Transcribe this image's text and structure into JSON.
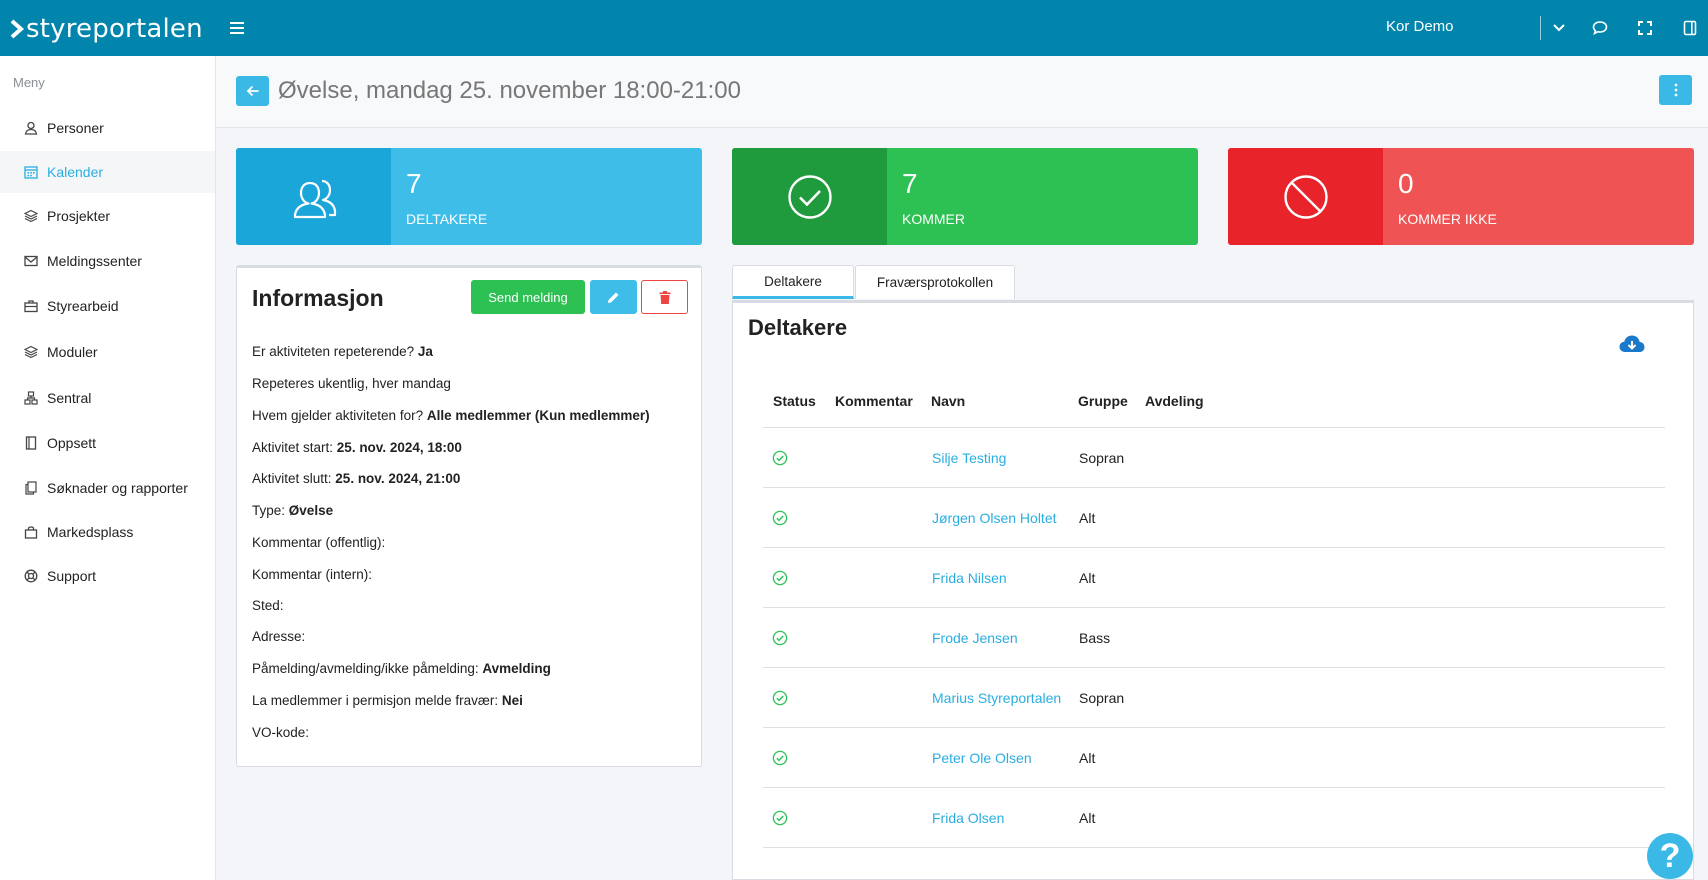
{
  "header": {
    "brand": "styreportalen",
    "org_name": "Kor Demo",
    "icons": [
      "menu-icon",
      "chevron-down-icon",
      "chat-bubble-icon",
      "fullscreen-icon",
      "sidebar-panel-icon"
    ]
  },
  "sidebar": {
    "title": "Meny",
    "items": [
      {
        "label": "Personer",
        "icon": "user-icon"
      },
      {
        "label": "Kalender",
        "icon": "calendar-icon",
        "active": true
      },
      {
        "label": "Prosjekter",
        "icon": "layers-icon"
      },
      {
        "label": "Meldingssenter",
        "icon": "mail-icon"
      },
      {
        "label": "Styrearbeid",
        "icon": "briefcase-icon"
      },
      {
        "label": "Moduler",
        "icon": "layers-icon"
      },
      {
        "label": "Sentral",
        "icon": "sitemap-icon"
      },
      {
        "label": "Oppsett",
        "icon": "book-icon"
      },
      {
        "label": "Søknader og rapporter",
        "icon": "documents-icon"
      },
      {
        "label": "Markedsplass",
        "icon": "shopping-bag-icon"
      },
      {
        "label": "Support",
        "icon": "lifebuoy-icon"
      }
    ]
  },
  "page": {
    "title": "Øvelse, mandag 25. november 18:00-21:00"
  },
  "stats": [
    {
      "value": "7",
      "label": "DELTAKERE",
      "icon": "users-icon",
      "color": "#3dbde8"
    },
    {
      "value": "7",
      "label": "KOMMER",
      "icon": "check-circle-icon",
      "color": "#2cc152"
    },
    {
      "value": "0",
      "label": "KOMMER IKKE",
      "icon": "ban-icon",
      "color": "#ef5353"
    }
  ],
  "info": {
    "title": "Informasjon",
    "send_label": "Send melding",
    "lines": [
      {
        "label": "Er aktiviteten repeterende?",
        "value": "Ja"
      },
      {
        "label": "Repeteres ukentlig, hver mandag",
        "value": ""
      },
      {
        "label": "Hvem gjelder aktiviteten for?",
        "value": "Alle medlemmer (Kun medlemmer)"
      },
      {
        "label": "Aktivitet start:",
        "value": "25. nov. 2024, 18:00"
      },
      {
        "label": "Aktivitet slutt:",
        "value": "25. nov. 2024, 21:00"
      },
      {
        "label": "Type:",
        "value": "Øvelse"
      },
      {
        "label": "Kommentar (offentlig):",
        "value": ""
      },
      {
        "label": "Kommentar (intern):",
        "value": ""
      },
      {
        "label": "Sted:",
        "value": ""
      },
      {
        "label": "Adresse:",
        "value": ""
      },
      {
        "label": "Påmelding/avmelding/ikke påmelding:",
        "value": "Avmelding"
      },
      {
        "label": "La medlemmer i permisjon melde fravær:",
        "value": "Nei"
      },
      {
        "label": "VO-kode:",
        "value": ""
      }
    ]
  },
  "tabs": [
    {
      "label": "Deltakere",
      "active": true
    },
    {
      "label": "Fraværsprotokollen",
      "active": false
    }
  ],
  "participants": {
    "title": "Deltakere",
    "columns": [
      "Status",
      "Kommentar",
      "Navn",
      "Gruppe",
      "Avdeling"
    ],
    "rows": [
      {
        "name": "Silje Testing",
        "group": "Sopran"
      },
      {
        "name": "Jørgen Olsen Holtet",
        "group": "Alt"
      },
      {
        "name": "Frida Nilsen",
        "group": "Alt"
      },
      {
        "name": "Frode Jensen",
        "group": "Bass"
      },
      {
        "name": "Marius Styreportalen",
        "group": "Sopran"
      },
      {
        "name": "Peter Ole Olsen",
        "group": "Alt"
      },
      {
        "name": "Frida Olsen",
        "group": "Alt"
      }
    ]
  },
  "help_label": "?"
}
